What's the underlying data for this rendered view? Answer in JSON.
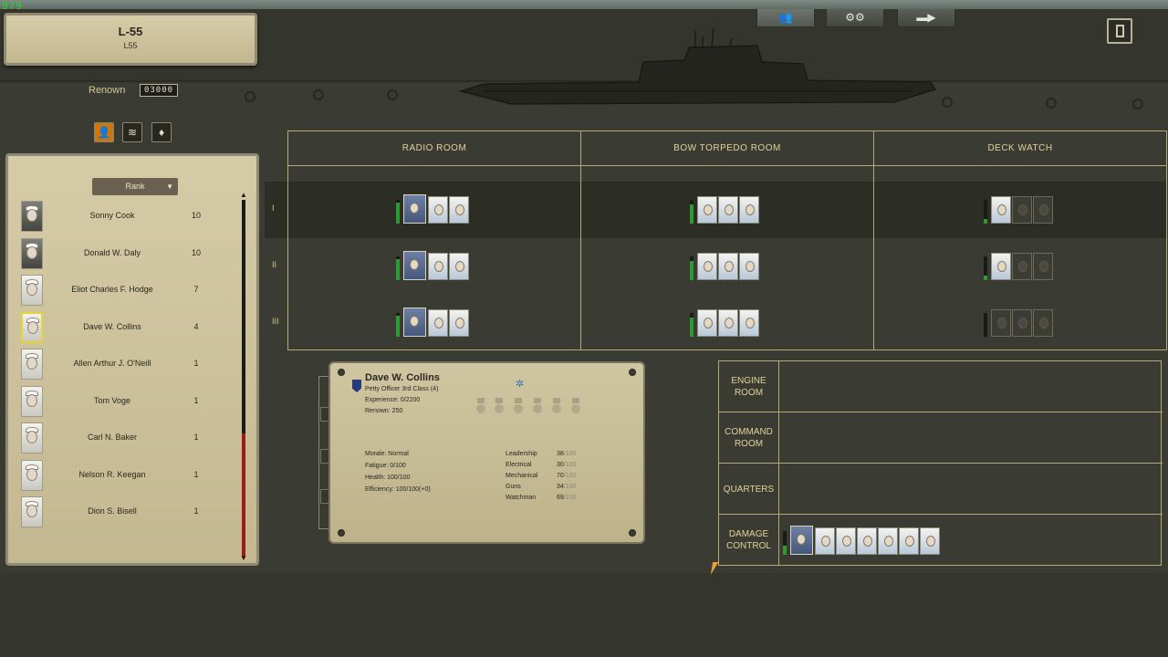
{
  "hud": {
    "fps": "979"
  },
  "submarine": {
    "name": "L-55",
    "code": "L55"
  },
  "renown": {
    "label": "Renown",
    "value": "03000"
  },
  "filters": [
    {
      "name": "crew-filter-person",
      "glyph": "👤",
      "active": true
    },
    {
      "name": "crew-filter-rank-chevrons",
      "glyph": "≋",
      "active": false
    },
    {
      "name": "crew-filter-medal",
      "glyph": "♦",
      "active": false
    }
  ],
  "top_tabs": [
    {
      "name": "tab-crew",
      "glyph": "👥",
      "active": true
    },
    {
      "name": "tab-equipment",
      "glyph": "⚙⚙",
      "active": false
    },
    {
      "name": "tab-torpedoes",
      "glyph": "▬▶",
      "active": false
    }
  ],
  "crew_list": {
    "sort_label": "Rank",
    "members": [
      {
        "name": "Sonny Cook",
        "rank": "10",
        "dark": true,
        "selected": false
      },
      {
        "name": "Donald W. Daly",
        "rank": "10",
        "dark": true,
        "selected": false
      },
      {
        "name": "Eliot Charles F. Hodge",
        "rank": "7",
        "dark": false,
        "selected": false
      },
      {
        "name": "Dave W. Collins",
        "rank": "4",
        "dark": false,
        "selected": true
      },
      {
        "name": "Allen Arthur J. O'Neill",
        "rank": "1",
        "dark": false,
        "selected": false
      },
      {
        "name": "Tom Voge",
        "rank": "1",
        "dark": false,
        "selected": false
      },
      {
        "name": "Carl N. Baker",
        "rank": "1",
        "dark": false,
        "selected": false
      },
      {
        "name": "Nelson R. Keegan",
        "rank": "1",
        "dark": false,
        "selected": false
      },
      {
        "name": "Dion S. Bisell",
        "rank": "1",
        "dark": false,
        "selected": false
      }
    ]
  },
  "compartments": {
    "headers": [
      "RADIO ROOM",
      "BOW TORPEDO ROOM",
      "DECK WATCH"
    ],
    "watches": [
      {
        "label": "I",
        "cells": [
          {
            "fill": 0.9,
            "slots": [
              "officer",
              "crew",
              "crew"
            ]
          },
          {
            "fill": 0.8,
            "slots": [
              "crew",
              "crew",
              "crew"
            ]
          },
          {
            "fill": 0.2,
            "slots": [
              "crew",
              "empty",
              "empty"
            ]
          }
        ]
      },
      {
        "label": "II",
        "cells": [
          {
            "fill": 0.9,
            "slots": [
              "officer",
              "crew",
              "crew"
            ]
          },
          {
            "fill": 0.8,
            "slots": [
              "crew",
              "crew",
              "crew"
            ]
          },
          {
            "fill": 0.2,
            "slots": [
              "crew",
              "empty",
              "empty"
            ]
          }
        ]
      },
      {
        "label": "III",
        "cells": [
          {
            "fill": 0.9,
            "slots": [
              "officer",
              "crew",
              "crew"
            ]
          },
          {
            "fill": 0.8,
            "slots": [
              "crew",
              "crew",
              "crew"
            ]
          },
          {
            "fill": 0,
            "slots": [
              "empty",
              "empty",
              "empty"
            ]
          }
        ]
      }
    ],
    "other_rooms": [
      {
        "label": "ENGINE ROOM",
        "slots": []
      },
      {
        "label": "COMMAND ROOM",
        "slots": []
      },
      {
        "label": "QUARTERS",
        "slots": []
      },
      {
        "label": "DAMAGE CONTROL",
        "fill": 0.4,
        "slots": [
          "officer",
          "crew",
          "crew",
          "crew",
          "crew",
          "crew",
          "crew"
        ]
      }
    ]
  },
  "selected_crew": {
    "name": "Dave W. Collins",
    "rank": "Petty Officer 3rd Class (4)",
    "experience": "Experience: 0/2200",
    "renown": "Renown: 250",
    "status": [
      "Morale: Normal",
      "Fatigue: 0/100",
      "Health: 100/100",
      "Efficiency: 100/100(+0)"
    ],
    "skills": [
      {
        "label": "Leadership",
        "value": "38",
        "max": "/100"
      },
      {
        "label": "Electrical",
        "value": "30",
        "max": "/100"
      },
      {
        "label": "Mechanical",
        "value": "70",
        "max": "/100"
      },
      {
        "label": "Guns",
        "value": "34",
        "max": "/100"
      },
      {
        "label": "Watchman",
        "value": "69",
        "max": "/100"
      }
    ]
  }
}
